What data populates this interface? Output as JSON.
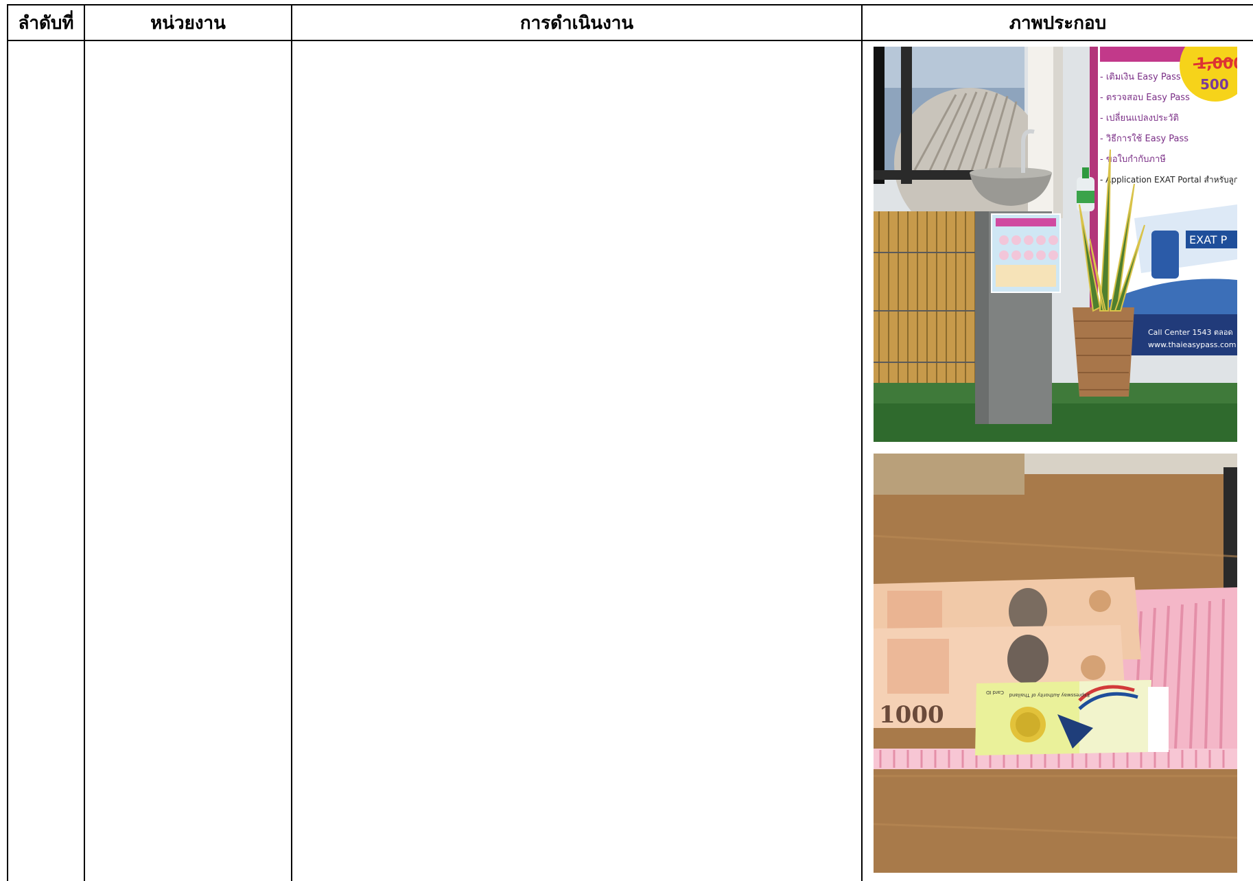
{
  "table": {
    "headers": {
      "order": "ลำดับที่",
      "unit": "หน่วยงาน",
      "operation": "การดำเนินงาน",
      "photos": "ภาพประกอบ"
    },
    "row": {
      "order": "",
      "unit": "",
      "operation": "",
      "photo_1": {
        "sign_lines": [
          "- เติมเงิน Easy Pass",
          "- ตรวจสอบ Easy Pass",
          "- เปลี่ยนแปลงประวัติ",
          "- วิธีการใช้ Easy Pass",
          "- ขอใบกำกับภาษี",
          "- Application EXAT Portal สำหรับลูกค้า Easy Pass"
        ],
        "price_old": "1,000",
        "price_new": "500",
        "exat_banner": "EXAT P",
        "call_center": "Call Center 1543 ตลอด",
        "website": "www.thaieasypass.com"
      },
      "photo_2": {
        "banknote_value": "1000",
        "card_authority": "Expressway Authority of Thailand",
        "card_label": "Card ID"
      }
    }
  }
}
